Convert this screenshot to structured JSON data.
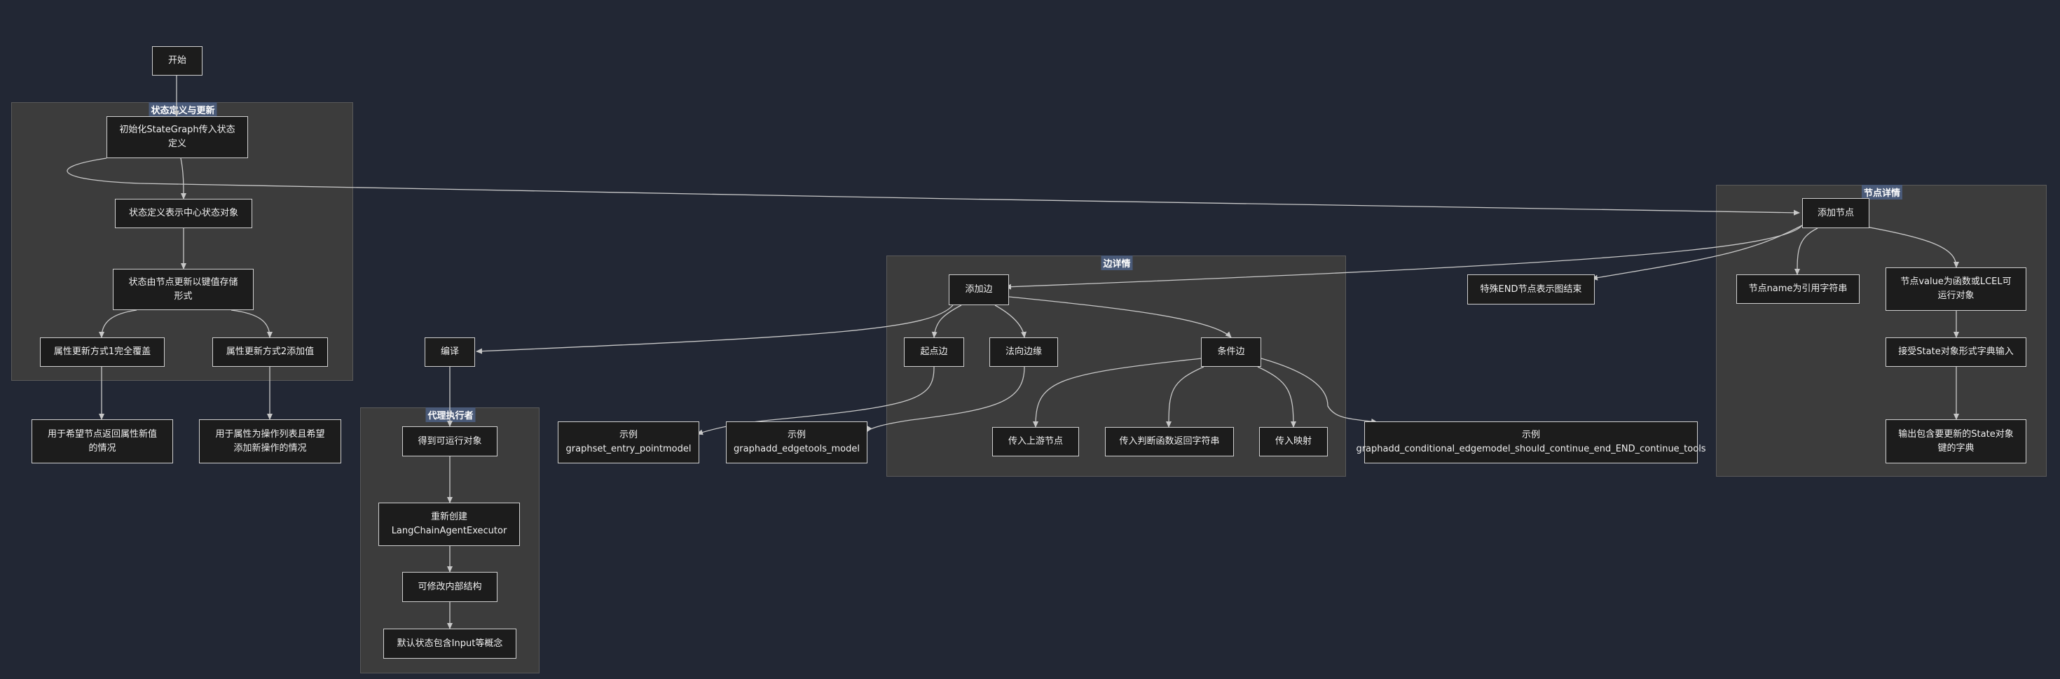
{
  "colors": {
    "background": "#222734",
    "cluster_fill": "#3c3c3c",
    "node_fill": "#1c1c1c",
    "node_border": "#cfcfcf",
    "edge": "#c8c8c8",
    "cluster_title_bg": "#4a5a78"
  },
  "clusters": {
    "state": {
      "title": "状态定义与更新"
    },
    "agent": {
      "title": "代理执行者"
    },
    "edges": {
      "title": "边详情"
    },
    "nodes": {
      "title": "节点详情"
    }
  },
  "nodes": {
    "start": "开始",
    "init": "初始化StateGraph传入状态\n定义",
    "central": "状态定义表示中心状态对象",
    "kvstore": "状态由节点更新以键值存储\n形式",
    "attr1": "属性更新方式1完全覆盖",
    "attr2": "属性更新方式2添加值",
    "new_value": "用于希望节点返回属性新值\n的情况",
    "append": "用于属性为操作列表且希望\n添加新操作的情况",
    "compile": "编译",
    "runnable": "得到可运行对象",
    "recreate": "重新创建\nLangChainAgentExecutor",
    "modify": "可修改内部结构",
    "default_input": "默认状态包含Input等概念",
    "add_edge": "添加边",
    "start_edge": "起点边",
    "normal_edge": "法向边缘",
    "cond_edge": "条件边",
    "upstream": "传入上游节点",
    "judge": "传入判断函数返回字符串",
    "mapping": "传入映射",
    "ex_entry": "示例\ngraphset_entry_pointmodel",
    "ex_edge": "示例\ngraphadd_edgetools_model",
    "ex_cond": "示例\ngraphadd_conditional_edgemodel_should_continue_end_END_continue_tools",
    "add_node": "添加节点",
    "end_node": "特殊END节点表示图结束",
    "node_name": "节点name为引用字符串",
    "node_value": "节点value为函数或LCEL可\n运行对象",
    "accept_state": "接受State对象形式字典输入",
    "output_dict": "输出包含要更新的State对象\n键的字典"
  }
}
